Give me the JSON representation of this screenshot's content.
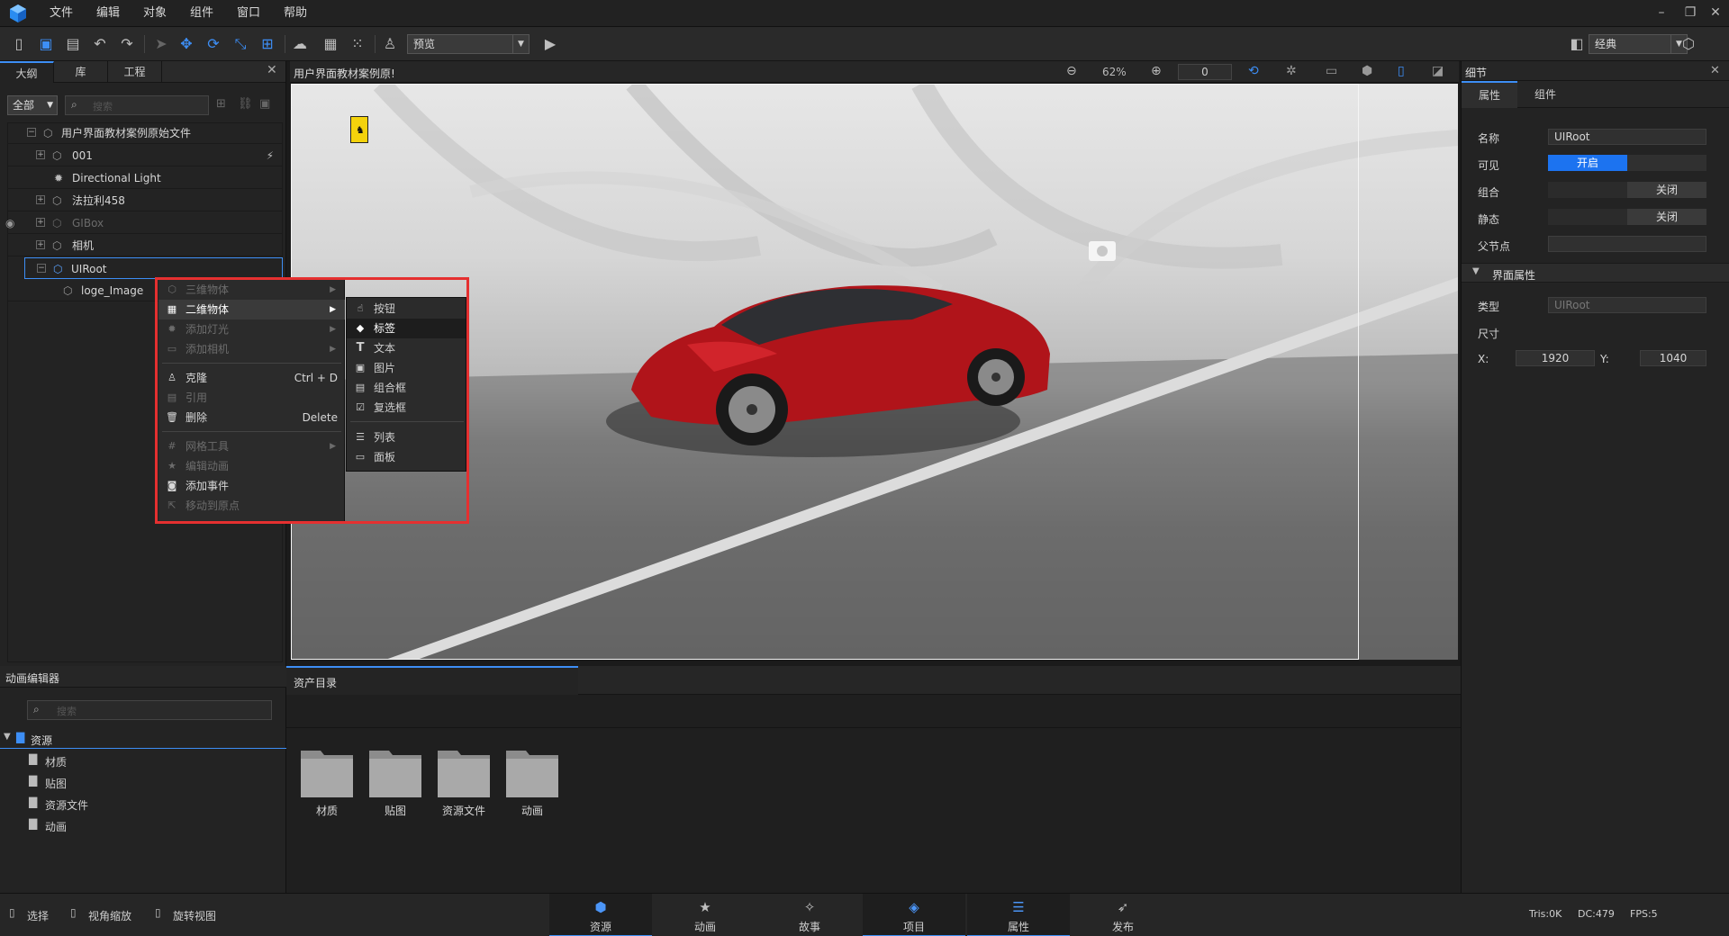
{
  "menubar": {
    "items": [
      "文件",
      "编辑",
      "对象",
      "组件",
      "窗口",
      "帮助"
    ]
  },
  "toolbar": {
    "preview_select": "预览",
    "layout_select": "经典",
    "zoom": "62%",
    "frame_value": "0"
  },
  "outline": {
    "tabs": [
      "大纲",
      "库",
      "工程"
    ],
    "filter": "全部",
    "search_placeholder": "搜索",
    "items": [
      {
        "label": "用户界面教材案例原始文件"
      },
      {
        "label": "001"
      },
      {
        "label": "Directional Light"
      },
      {
        "label": "法拉利458"
      },
      {
        "label": "GIBox"
      },
      {
        "label": "相机"
      },
      {
        "label": "UIRoot"
      },
      {
        "label": "loge_Image"
      }
    ]
  },
  "viewport": {
    "title": "用户界面教材案例原!"
  },
  "context_menu": {
    "items": [
      {
        "label": "三维物体",
        "state": "disabled"
      },
      {
        "label": "二维物体",
        "state": "highlighted"
      },
      {
        "label": "添加灯光",
        "state": "disabled"
      },
      {
        "label": "添加相机",
        "state": "disabled"
      },
      {
        "label": "克隆",
        "shortcut": "Ctrl + D"
      },
      {
        "label": "引用",
        "state": "disabled"
      },
      {
        "label": "删除",
        "shortcut": "Delete"
      },
      {
        "label": "网格工具",
        "state": "disabled"
      },
      {
        "label": "编辑动画",
        "state": "disabled"
      },
      {
        "label": "添加事件"
      },
      {
        "label": "移动到原点",
        "state": "disabled"
      }
    ],
    "submenu": [
      {
        "label": "按钮"
      },
      {
        "label": "标签",
        "state": "highlighted"
      },
      {
        "label": "文本"
      },
      {
        "label": "图片"
      },
      {
        "label": "组合框"
      },
      {
        "label": "复选框"
      },
      {
        "label": "列表"
      },
      {
        "label": "面板"
      }
    ]
  },
  "details": {
    "title": "细节",
    "tabs": [
      "属性",
      "组件"
    ],
    "name_label": "名称",
    "name_value": "UIRoot",
    "visible_label": "可见",
    "visible_value": "开启",
    "group_label": "组合",
    "group_value": "关闭",
    "static_label": "静态",
    "static_value": "关闭",
    "parent_label": "父节点",
    "section_title": "界面属性",
    "type_label": "类型",
    "type_value": "UIRoot",
    "size_label": "尺寸",
    "x_label": "X:",
    "x_value": "1920",
    "y_label": "Y:",
    "y_value": "1040"
  },
  "anim_editor": {
    "title": "动画编辑器",
    "search_placeholder": "搜索",
    "root": "资源",
    "children": [
      "材质",
      "贴图",
      "资源文件",
      "动画"
    ]
  },
  "assets": {
    "tab": "资产目录",
    "folders": [
      "材质",
      "贴图",
      "资源文件",
      "动画"
    ]
  },
  "statusbar": {
    "hints": [
      "选择",
      "视角缩放",
      "旋转视图"
    ],
    "nav": [
      "资源",
      "动画",
      "故事",
      "项目",
      "属性",
      "发布"
    ],
    "tris": "Tris:0K",
    "dc": "DC:479",
    "fps": "FPS:5"
  },
  "colors": {
    "accent": "#3d8ef5",
    "highlight_outline": "#e53030",
    "toggle_on": "#1c73f0",
    "car_red": "#b0141a"
  }
}
